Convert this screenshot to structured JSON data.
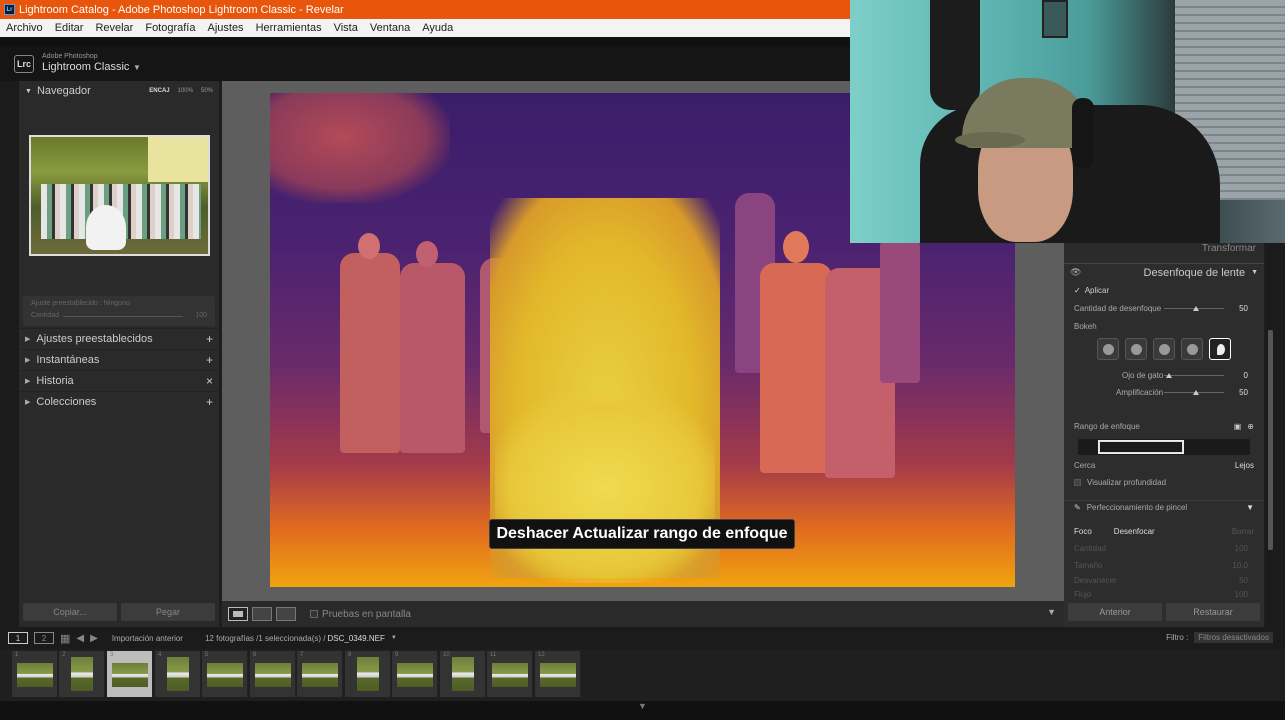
{
  "window": {
    "title": "Lightroom Catalog - Adobe Photoshop Lightroom Classic - Revelar"
  },
  "menu": [
    "Archivo",
    "Editar",
    "Revelar",
    "Fotografía",
    "Ajustes",
    "Herramientas",
    "Vista",
    "Ventana",
    "Ayuda"
  ],
  "identity": {
    "logo": "Lrc",
    "adobe": "Adobe Photoshop",
    "product": "Lightroom Classic"
  },
  "left_panel": {
    "navigator": {
      "title": "Navegador",
      "zooms": [
        "ENCAJ",
        "100%",
        "50%"
      ]
    },
    "preset_box": {
      "line1": "Ajuste preestablecido : Ninguno",
      "line2": "Cantidad",
      "value": "100"
    },
    "sections": [
      {
        "label": "Ajustes preestablecidos",
        "action": "+"
      },
      {
        "label": "Instantáneas",
        "action": "+"
      },
      {
        "label": "Historia",
        "action": "×"
      },
      {
        "label": "Colecciones",
        "action": "+"
      }
    ],
    "buttons": {
      "copy": "Copiar...",
      "paste": "Pegar"
    }
  },
  "canvas": {
    "caption": "Deshacer Actualizar rango de enfoque"
  },
  "toolbar": {
    "proof": "Pruebas en pantalla"
  },
  "right_panel": {
    "cutoff_label": "Transformar",
    "section_title": "Desenfoque de lente",
    "apply": "Aplicar",
    "blur_amount": {
      "label": "Cantidad de desenfoque",
      "value": "50"
    },
    "bokeh_label": "Bokeh",
    "cat_eye": {
      "label": "Ojo de gato",
      "value": "0"
    },
    "amplification": {
      "label": "Amplificación",
      "value": "50"
    },
    "focus_range": "Rango de enfoque",
    "near": "Cerca",
    "far": "Lejos",
    "visualize_depth": "Visualizar profundidad",
    "brush_refine": "Perfeccionamiento de pincel",
    "focus_btn": "Foco",
    "blur_btn": "Desenfocar",
    "erase_btn": "Borrar",
    "faded_rows": [
      {
        "label": "Cantidad",
        "value": "100"
      },
      {
        "label": "Tamaño",
        "value": "10,0"
      },
      {
        "label": "Desvanecer",
        "value": "50"
      },
      {
        "label": "Flujo",
        "value": "100"
      }
    ],
    "buttons": {
      "previous": "Anterior",
      "reset": "Restaurar"
    }
  },
  "filmbar": {
    "source": "Importación anterior",
    "count": "12 fotografías /1 seleccionada(s) /",
    "file": "DSC_0349.NEF",
    "filter_label": "Filtro :",
    "filter_value": "Filtros desactivados"
  },
  "filmstrip": {
    "numbers": [
      "1",
      "2",
      "3",
      "4",
      "5",
      "6",
      "7",
      "8",
      "9",
      "10",
      "11",
      "12"
    ],
    "selected": "3"
  }
}
